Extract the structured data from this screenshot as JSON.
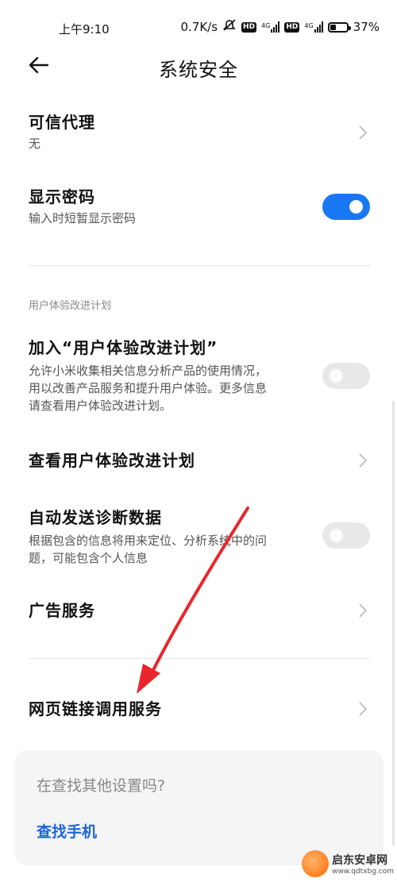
{
  "status_bar": {
    "time": "上午9:10",
    "speed": "0.7K/s",
    "battery": "37%",
    "battery_level": 0.37
  },
  "header": {
    "title": "系统安全"
  },
  "items": {
    "trusted_agent": {
      "label": "可信代理",
      "value": "无"
    },
    "show_password": {
      "label": "显示密码",
      "description": "输入时短暂显示密码",
      "enabled": true
    },
    "section_title": "用户体验改进计划",
    "join_plan": {
      "label": "加入“用户体验改进计划”",
      "desc_line1": "允许小米收集相关信息分析产品的使用情况，",
      "desc_line2": "用以改善产品服务和提升用户体验。更多信息",
      "desc_line3": "请查看用户体验改进计划。",
      "enabled": false
    },
    "view_plan": {
      "label": "查看用户体验改进计划"
    },
    "auto_diag": {
      "label": "自动发送诊断数据",
      "desc_line1": "根据包含的信息将用来定位、分析系统中的问",
      "desc_line2": "题，可能包含个人信息",
      "enabled": false
    },
    "ad_service": {
      "label": "广告服务"
    },
    "web_link": {
      "label": "网页链接调用服务"
    }
  },
  "search_card": {
    "question": "在查找其他设置吗?",
    "link": "查找手机"
  },
  "watermark": {
    "name": "启东安卓网",
    "url": "www.qdtxbg.com"
  },
  "colors": {
    "accent": "#1877f2",
    "link": "#1e66d4",
    "annotation_arrow": "#e8262b"
  }
}
